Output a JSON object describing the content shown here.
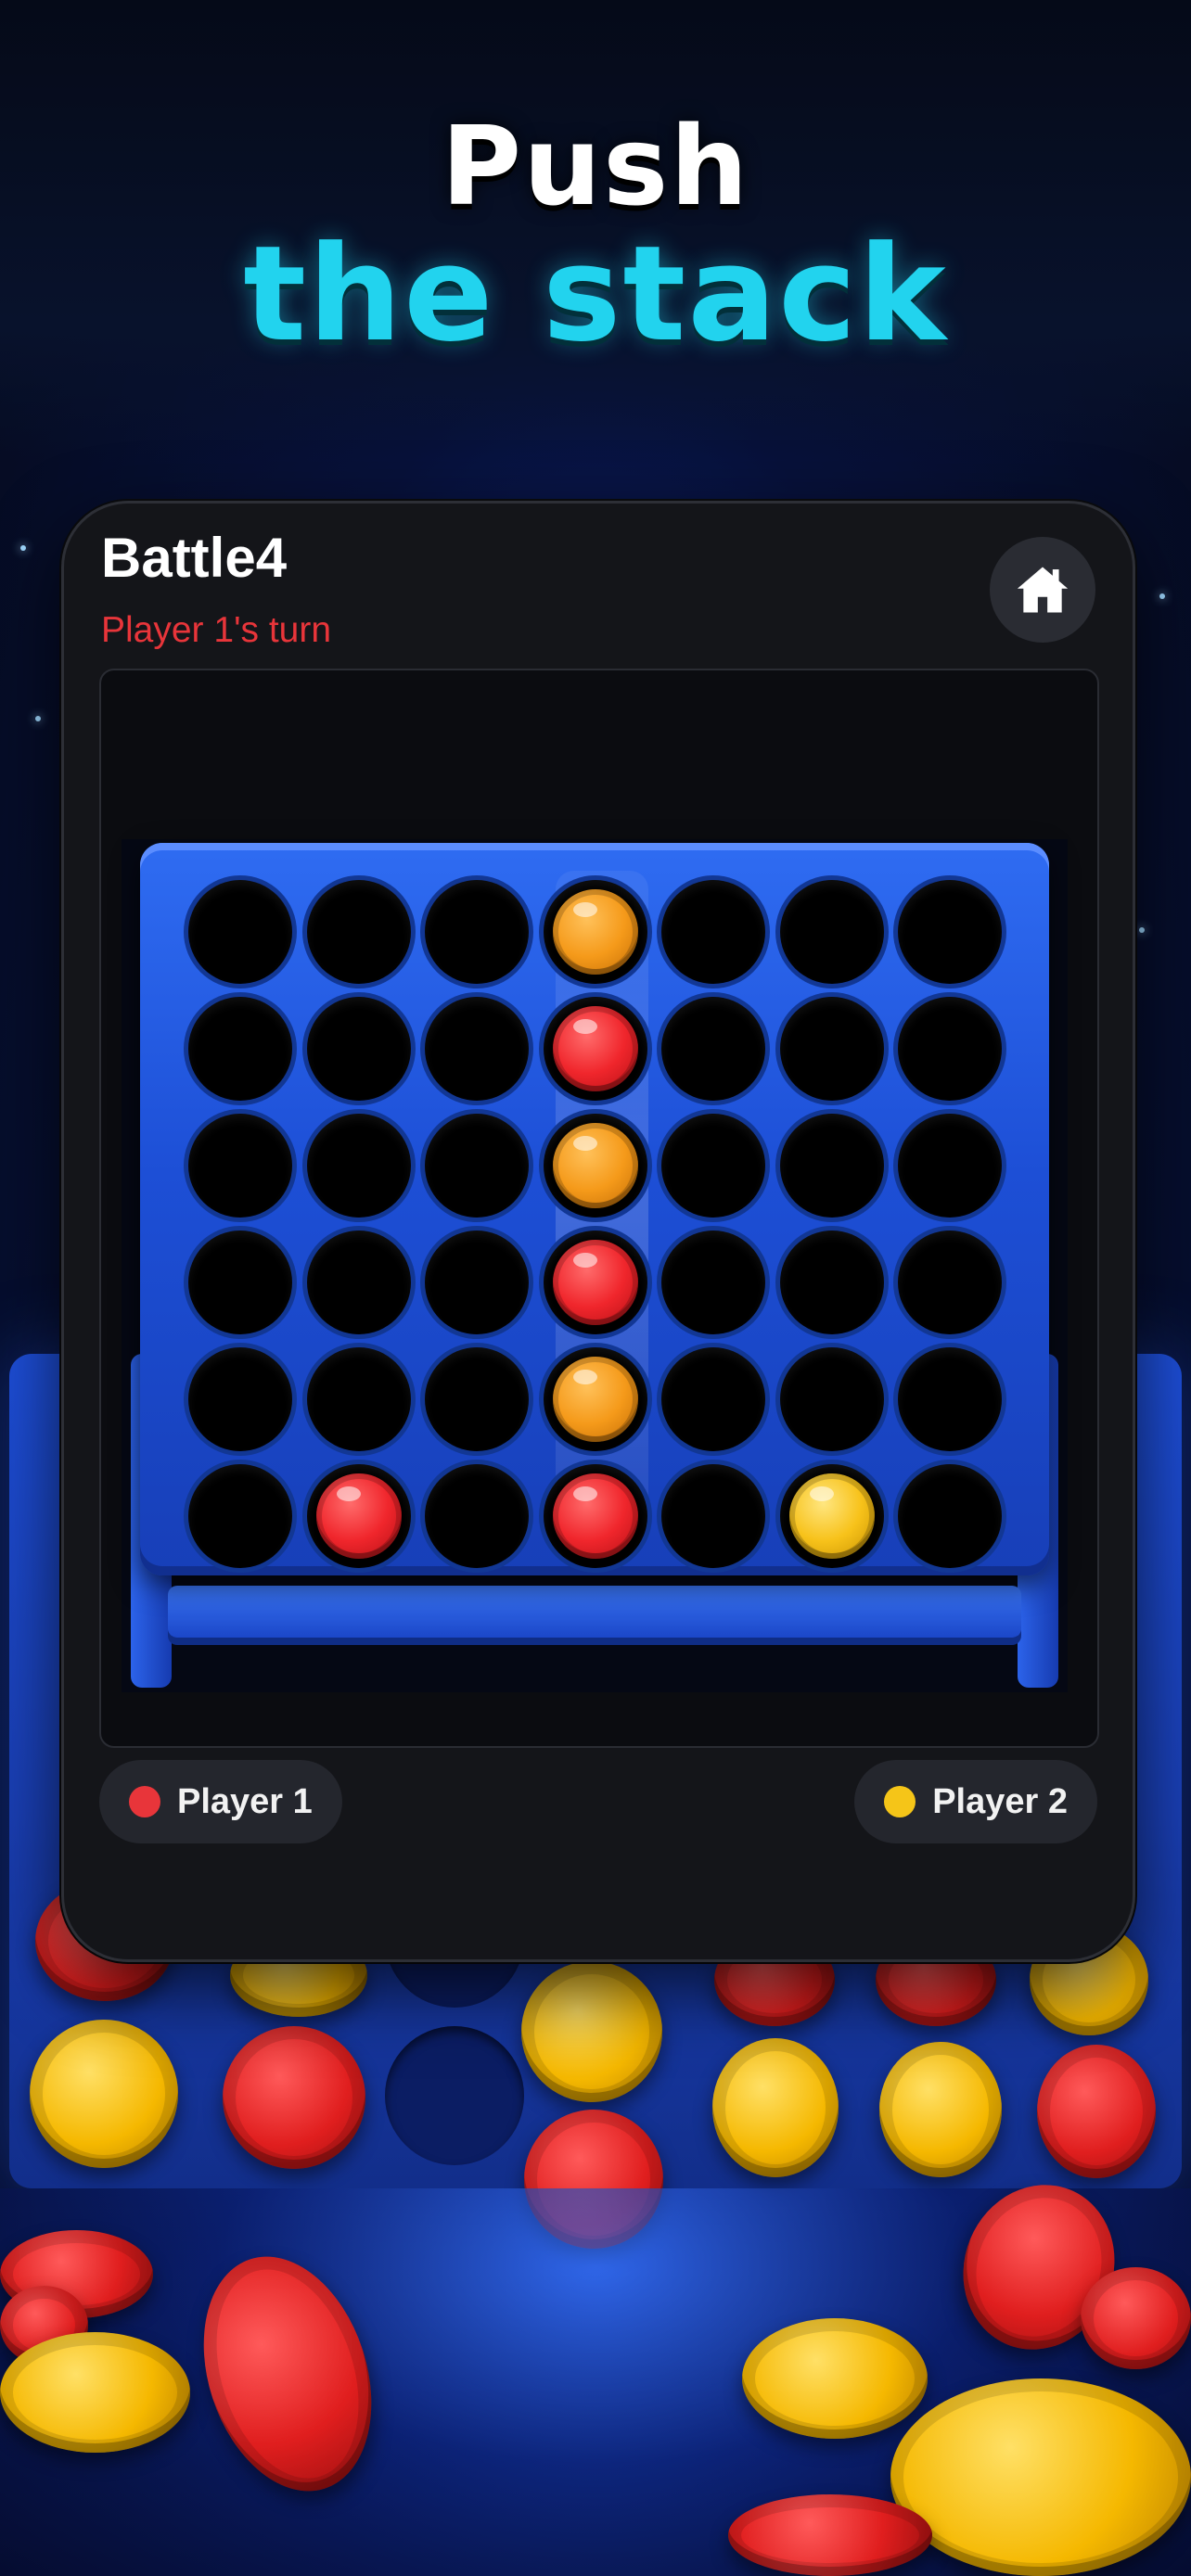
{
  "promo": {
    "line1": "Push",
    "line2": "the stack"
  },
  "app": {
    "title": "Battle4",
    "turn_status": "Player 1's turn",
    "home_icon": "home-icon"
  },
  "board": {
    "columns": 7,
    "rows": 6,
    "highlighted_column": 4,
    "grid": [
      [
        "empty",
        "empty",
        "empty",
        "orange",
        "empty",
        "empty",
        "empty"
      ],
      [
        "empty",
        "empty",
        "empty",
        "red",
        "empty",
        "empty",
        "empty"
      ],
      [
        "empty",
        "empty",
        "empty",
        "orange",
        "empty",
        "empty",
        "empty"
      ],
      [
        "empty",
        "empty",
        "empty",
        "red",
        "empty",
        "empty",
        "empty"
      ],
      [
        "empty",
        "empty",
        "empty",
        "orange",
        "empty",
        "empty",
        "empty"
      ],
      [
        "empty",
        "red",
        "empty",
        "red",
        "empty",
        "yellow",
        "empty"
      ]
    ]
  },
  "players": [
    {
      "label": "Player 1",
      "color": "#e8353a"
    },
    {
      "label": "Player 2",
      "color": "#f5c518"
    }
  ],
  "colors": {
    "accent_cyan": "#22d3ee",
    "turn_red": "#e8353a",
    "board_blue": "#1d4fd6"
  }
}
